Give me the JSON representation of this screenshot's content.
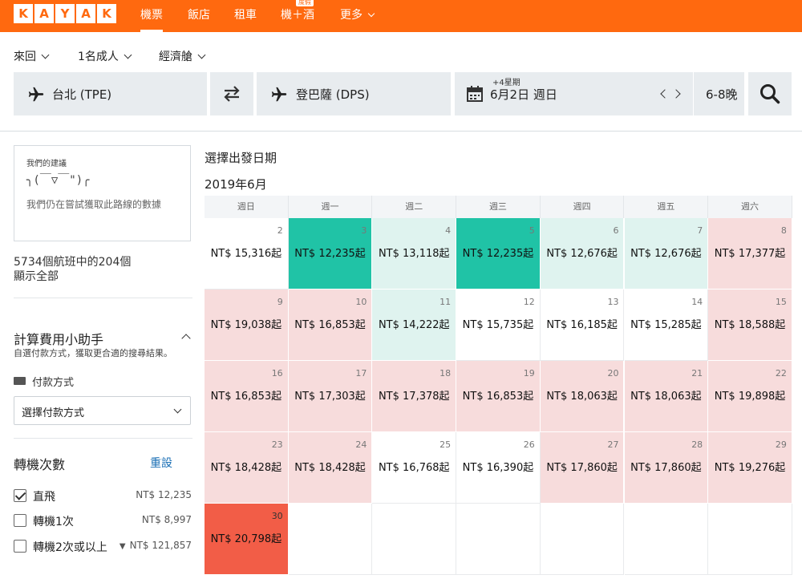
{
  "colors": {
    "brand": "#ff690f",
    "cheapest": "#20c3a6",
    "cheap": "#dff3ef",
    "expensive": "#f7dcdc",
    "most_expensive": "#f25d47",
    "link": "#1a6fb5"
  },
  "nav": {
    "logo_letters": [
      "K",
      "A",
      "Y",
      "A",
      "K"
    ],
    "items": [
      {
        "label": "機票",
        "active": true
      },
      {
        "label": "飯店",
        "active": false
      },
      {
        "label": "租車",
        "active": false
      },
      {
        "label": "機＋酒",
        "badge": "度假",
        "active": false
      },
      {
        "label": "更多",
        "active": false
      }
    ]
  },
  "search": {
    "trip_type": "來回",
    "travelers": "1名成人",
    "cabin": "經濟艙",
    "origin": "台北 (TPE)",
    "destination": "登巴薩 (DPS)",
    "date_note": "+4星期",
    "date": "6月2日 週日",
    "nights": "6-8晚",
    "icons": {
      "origin": "plane-icon",
      "swap": "swap-arrows-icon",
      "date": "calendar-icon",
      "prev": "chevron-left-icon",
      "next": "chevron-right-icon",
      "search": "search-icon"
    }
  },
  "sidebar": {
    "advice_heading": "我們的建議",
    "advice_face": "╮(￣▽￣\")╭",
    "advice_message": "我們仍在嘗試獲取此路線的數據",
    "flight_count": "5734個航班中的204個",
    "show_all": "顯示全部",
    "calc_title": "計算費用小助手",
    "calc_subtitle": "自選付款方式，獲取更合適的搜尋結果。",
    "payment_label": "付款方式",
    "payment_select": "選擇付款方式",
    "stops_title": "轉機次數",
    "reset": "重設",
    "stops": [
      {
        "label": "直飛",
        "price": "NT$ 12,235",
        "checked": true
      },
      {
        "label": "轉機1次",
        "price": "NT$ 8,997",
        "checked": false
      },
      {
        "label": "轉機2次或以上",
        "price": "NT$ 121,857",
        "checked": false
      }
    ]
  },
  "calendar": {
    "title": "選擇出發日期",
    "month": "2019年6月",
    "weekdays": [
      "週日",
      "週一",
      "週二",
      "週三",
      "週四",
      "週五",
      "週六"
    ],
    "weeks": [
      [
        {
          "day": "2",
          "price": "NT$ 15,316起",
          "level": "white"
        },
        {
          "day": "3",
          "price": "NT$ 12,235起",
          "level": "green"
        },
        {
          "day": "4",
          "price": "NT$ 13,118起",
          "level": "lightgreen"
        },
        {
          "day": "5",
          "price": "NT$ 12,235起",
          "level": "green"
        },
        {
          "day": "6",
          "price": "NT$ 12,676起",
          "level": "lightgreen"
        },
        {
          "day": "7",
          "price": "NT$ 12,676起",
          "level": "lightgreen"
        },
        {
          "day": "8",
          "price": "NT$ 17,377起",
          "level": "pink"
        }
      ],
      [
        {
          "day": "9",
          "price": "NT$ 19,038起",
          "level": "pink"
        },
        {
          "day": "10",
          "price": "NT$ 16,853起",
          "level": "pink"
        },
        {
          "day": "11",
          "price": "NT$ 14,222起",
          "level": "lightgreen"
        },
        {
          "day": "12",
          "price": "NT$ 15,735起",
          "level": "white"
        },
        {
          "day": "13",
          "price": "NT$ 16,185起",
          "level": "white"
        },
        {
          "day": "14",
          "price": "NT$ 15,285起",
          "level": "white"
        },
        {
          "day": "15",
          "price": "NT$ 18,588起",
          "level": "pink"
        }
      ],
      [
        {
          "day": "16",
          "price": "NT$ 16,853起",
          "level": "pink"
        },
        {
          "day": "17",
          "price": "NT$ 17,303起",
          "level": "pink"
        },
        {
          "day": "18",
          "price": "NT$ 17,378起",
          "level": "pink"
        },
        {
          "day": "19",
          "price": "NT$ 16,853起",
          "level": "pink"
        },
        {
          "day": "20",
          "price": "NT$ 18,063起",
          "level": "pink"
        },
        {
          "day": "21",
          "price": "NT$ 18,063起",
          "level": "pink"
        },
        {
          "day": "22",
          "price": "NT$ 19,898起",
          "level": "pink"
        }
      ],
      [
        {
          "day": "23",
          "price": "NT$ 18,428起",
          "level": "pink"
        },
        {
          "day": "24",
          "price": "NT$ 18,428起",
          "level": "pink"
        },
        {
          "day": "25",
          "price": "NT$ 16,768起",
          "level": "white"
        },
        {
          "day": "26",
          "price": "NT$ 16,390起",
          "level": "white"
        },
        {
          "day": "27",
          "price": "NT$ 17,860起",
          "level": "pink"
        },
        {
          "day": "28",
          "price": "NT$ 17,860起",
          "level": "pink"
        },
        {
          "day": "29",
          "price": "NT$ 19,276起",
          "level": "pink"
        }
      ],
      [
        {
          "day": "30",
          "price": "NT$ 20,798起",
          "level": "red"
        },
        null,
        null,
        null,
        null,
        null,
        null
      ]
    ]
  }
}
